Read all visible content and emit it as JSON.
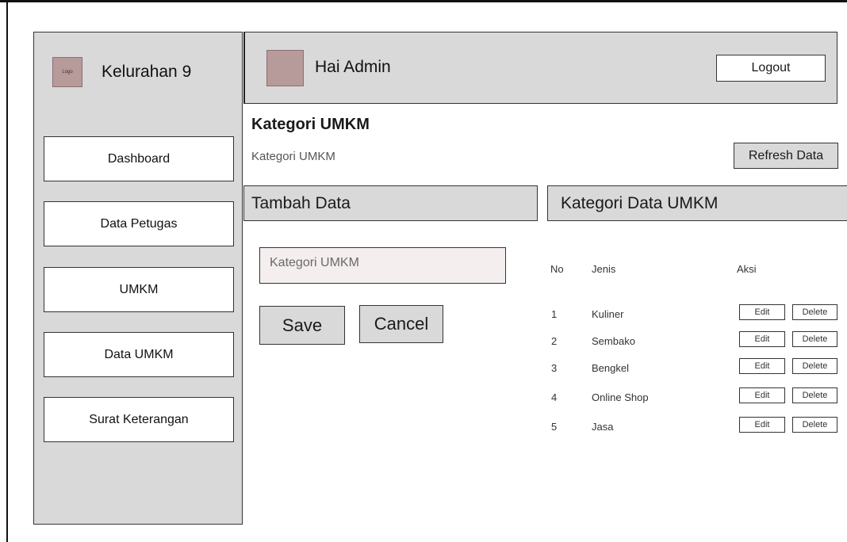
{
  "sidebar": {
    "logo_text": "Logo",
    "title": "Kelurahan 9",
    "items": [
      {
        "label": "Dashboard"
      },
      {
        "label": "Data Petugas"
      },
      {
        "label": "UMKM"
      },
      {
        "label": "Data UMKM"
      },
      {
        "label": "Surat Keterangan"
      }
    ]
  },
  "header": {
    "greeting": "Hai Admin",
    "logout_label": "Logout"
  },
  "page": {
    "title": "Kategori UMKM",
    "subtitle": "Kategori UMKM",
    "refresh_label": "Refresh Data"
  },
  "form": {
    "heading": "Tambah Data",
    "input_placeholder": "Kategori UMKM",
    "input_value": "",
    "save_label": "Save",
    "cancel_label": "Cancel"
  },
  "table": {
    "heading": "Kategori Data UMKM",
    "columns": [
      "No",
      "Jenis",
      "Aksi"
    ],
    "rows": [
      {
        "no": "1",
        "jenis": "Kuliner",
        "edit": "Edit",
        "delete": "Delete"
      },
      {
        "no": "2",
        "jenis": "Sembako",
        "edit": "Edit",
        "delete": "Delete"
      },
      {
        "no": "3",
        "jenis": "Bengkel",
        "edit": "Edit",
        "delete": "Delete"
      },
      {
        "no": "4",
        "jenis": "Online Shop",
        "edit": "Edit",
        "delete": "Delete"
      },
      {
        "no": "5",
        "jenis": "Jasa",
        "edit": "Edit",
        "delete": "Delete"
      }
    ]
  },
  "colors": {
    "panel_gray": "#d9d9d9",
    "placeholder_pink": "#b79a9a",
    "input_bg": "#f4eeee",
    "border": "#333333"
  }
}
